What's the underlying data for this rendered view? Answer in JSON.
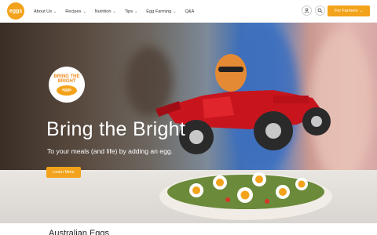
{
  "brand": {
    "logo_text": "eggs",
    "accent": "#f3a31b"
  },
  "nav": {
    "items": [
      {
        "label": "About Us",
        "dropdown": true
      },
      {
        "label": "Recipes",
        "dropdown": true
      },
      {
        "label": "Nutrition",
        "dropdown": true
      },
      {
        "label": "Tips",
        "dropdown": true
      },
      {
        "label": "Egg Farming",
        "dropdown": true
      },
      {
        "label": "Q&A",
        "dropdown": false
      }
    ],
    "account_icon": "user-icon",
    "search_icon": "search-icon",
    "farmers_label": "For Farmers"
  },
  "hero": {
    "badge_top": "BRING THE BRIGHT",
    "badge_egg": "eggs",
    "headline": "Bring the Bright",
    "subline": "To your meals (and life) by adding an egg.",
    "cta_label": "Learn More"
  },
  "below": {
    "title": "Australian Eggs"
  }
}
